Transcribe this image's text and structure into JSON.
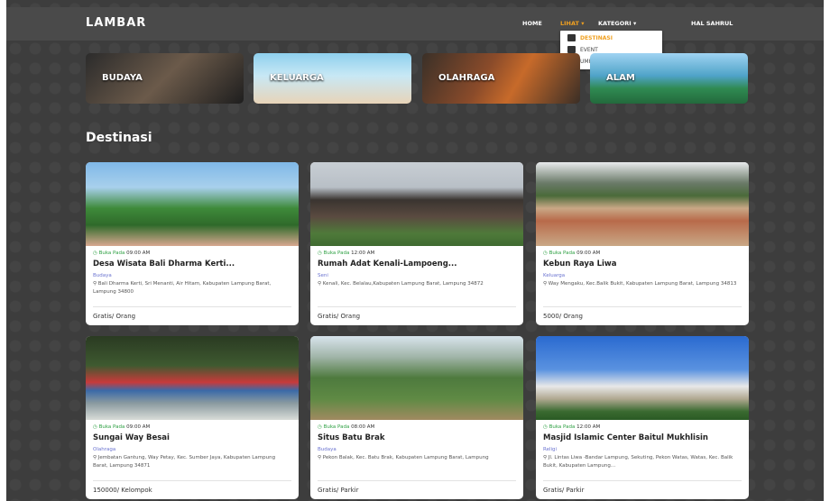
{
  "navbar": {
    "brand": "LAMBAR",
    "home": "HOME",
    "lihat": "LIHAT ▾",
    "kategori": "KATEGORI ▾",
    "hal": "HAL SAHRUL",
    "dropdown": [
      "DESTINASI",
      "EVENT",
      "UMKM"
    ]
  },
  "categories": [
    "BUDAYA",
    "KELUARGA",
    "OLAHRAGA",
    "ALAM"
  ],
  "section_title": "Destinasi",
  "cards": [
    {
      "open": "Buka Pada",
      "time": "09:00 AM",
      "title": "Desa Wisata Bali Dharma Kerti...",
      "category": "Budaya",
      "address": "Bali Dharma Kerti, Sri Menanti, Air Hitam, Kabupaten Lampung Barat, Lampung 34800",
      "price": "Gratis/ Orang"
    },
    {
      "open": "Buka Pada",
      "time": "12:00 AM",
      "title": "Rumah Adat Kenali-Lampoeng...",
      "category": "Seni",
      "address": "Kenali, Kec. Belalau,Kabupaten Lampung Barat, Lampung 34872",
      "price": "Gratis/ Orang"
    },
    {
      "open": "Buka Pada",
      "time": "09:00 AM",
      "title": "Kebun Raya Liwa",
      "category": "Keluarga",
      "address": "Way Mengaku, Kec.Balik Bukit, Kabupaten Lampung Barat, Lampung 34813",
      "price": "5000/ Orang"
    },
    {
      "open": "Buka Pada",
      "time": "09:00 AM",
      "title": "Sungai Way Besai",
      "category": "Olahraga",
      "address": "Jembatan Gantung, Way Petay, Kec. Sumber Jaya, Kabupaten Lampung Barat, Lampung 34871",
      "price": "150000/ Kelompok"
    },
    {
      "open": "Buka Pada",
      "time": "08:00 AM",
      "title": "Situs Batu Brak",
      "category": "Budaya",
      "address": "Pekon Balak, Kec. Batu Brak, Kabupaten Lampung Barat, Lampung",
      "price": "Gratis/ Parkir"
    },
    {
      "open": "Buka Pada",
      "time": "12:00 AM",
      "title": "Masjid Islamic Center Baitul Mukhlisin",
      "category": "Religi",
      "address": "Jl. Lintas Liwa -Bandar Lampung, Sekuting, Pekon Watas, Watas, Kec. Balik Bukit, Kabupaten Lampung...",
      "price": "Gratis/ Parkir"
    }
  ]
}
